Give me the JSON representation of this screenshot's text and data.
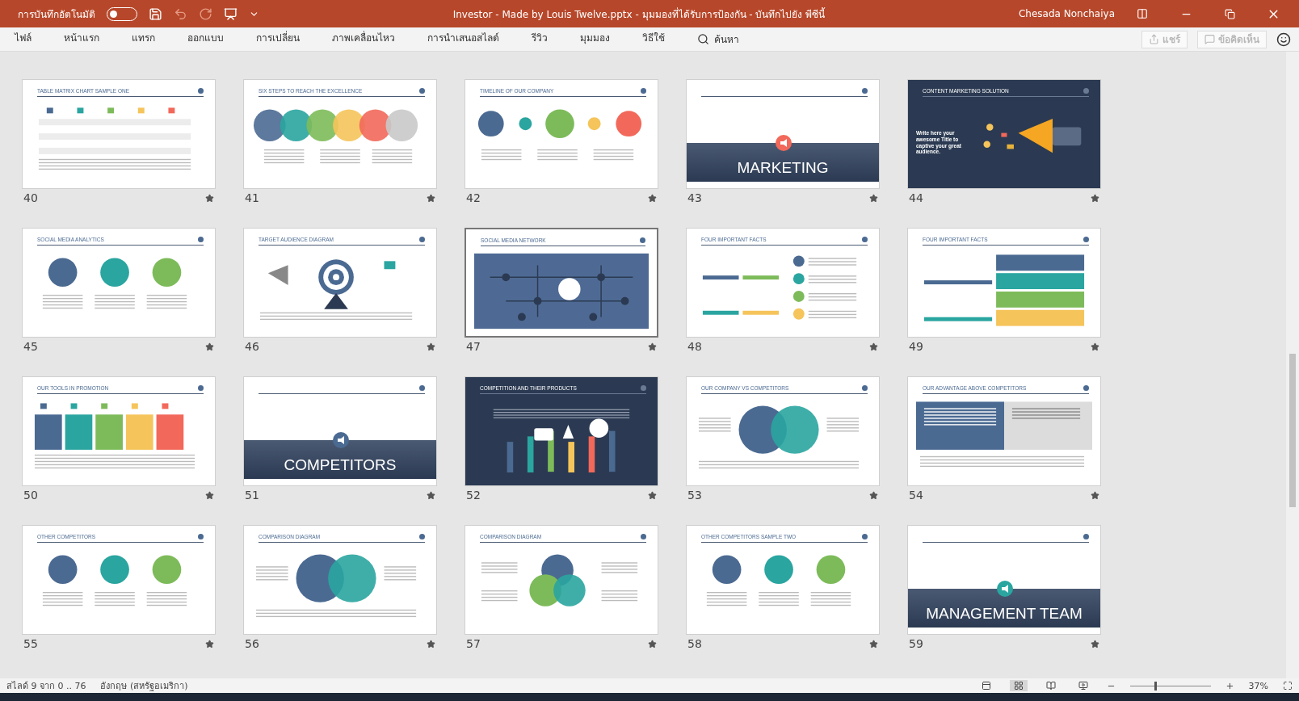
{
  "title_bar": {
    "autosave_label": "การบันทึกอัตโนมัติ",
    "autosave": {
      "on": false
    },
    "title": "Investor - Made by Louis Twelve.pptx  -  มุมมองที่ได้รับการป้องกัน  -  บันทึกไปยัง พีซีนี้",
    "user": "Chesada Nonchaiya"
  },
  "ribbon": {
    "tabs": [
      {
        "label": "ไฟล์",
        "selected": false
      },
      {
        "label": "หน้าแรก",
        "selected": false
      },
      {
        "label": "แทรก",
        "selected": false
      },
      {
        "label": "ออกแบบ",
        "selected": false
      },
      {
        "label": "การเปลี่ยน",
        "selected": false
      },
      {
        "label": "ภาพเคลื่อนไหว",
        "selected": false
      },
      {
        "label": "การนำเสนอสไลด์",
        "selected": false
      },
      {
        "label": "รีวิว",
        "selected": false
      },
      {
        "label": "มุมมอง",
        "selected": false
      },
      {
        "label": "วิธีใช้",
        "selected": false
      }
    ],
    "search": "ค้นหา",
    "buttons": [
      {
        "label": "แชร์",
        "kind": "share",
        "disabled": true
      },
      {
        "label": "ข้อคิดเห็น",
        "kind": "comment",
        "disabled": true
      }
    ]
  },
  "slides": [
    {
      "number": "40",
      "title": "TABLE MATRIX CHART SAMPLE ONE",
      "kind": "table",
      "selected": false
    },
    {
      "number": "41",
      "title": "SIX STEPS TO REACH THE EXCELLENCE",
      "kind": "circles",
      "selected": false
    },
    {
      "number": "42",
      "title": "TIMELINE OF OUR COMPANY",
      "kind": "timeline",
      "selected": false
    },
    {
      "number": "43",
      "title": "MARKETING",
      "kind": "megaphone",
      "selected": false
    },
    {
      "number": "44",
      "title": "CONTENT MARKETING SOLUTION",
      "lead": "Write here your awesome Title to captive your great audience.",
      "kind": "promo",
      "selected": false
    },
    {
      "number": "45",
      "title": "SOCIAL MEDIA ANALYTICS",
      "kind": "icons",
      "selected": false
    },
    {
      "number": "46",
      "title": "TARGET AUDIENCE DIAGRAM",
      "kind": "target",
      "selected": false
    },
    {
      "number": "47",
      "title": "SOCIAL MEDIA NETWORK",
      "kind": "network",
      "selected": true
    },
    {
      "number": "48",
      "title": "FOUR IMPORTANT FACTS",
      "kind": "list",
      "selected": false
    },
    {
      "number": "49",
      "title": "FOUR IMPORTANT FACTS",
      "kind": "bars",
      "selected": false
    },
    {
      "number": "50",
      "title": "OUR TOOLS IN PROMOTION",
      "kind": "cards",
      "selected": false
    },
    {
      "number": "51",
      "title": "COMPETITORS",
      "kind": "shuffle",
      "selected": false
    },
    {
      "number": "52",
      "title": "COMPETITION AND THEIR PRODUCTS",
      "kind": "crowd",
      "selected": false
    },
    {
      "number": "53",
      "title": "OUR COMPANY VS COMPETITORS",
      "kind": "venn",
      "selected": false
    },
    {
      "number": "54",
      "title": "OUR ADVANTAGE ABOVE COMPETITORS",
      "kind": "split",
      "selected": false
    },
    {
      "number": "55",
      "title": "OTHER COMPETITORS",
      "kind": "icons",
      "selected": false
    },
    {
      "number": "56",
      "title": "COMPARISON DIAGRAM",
      "kind": "venn",
      "selected": false
    },
    {
      "number": "57",
      "title": "COMPARISON DIAGRAM",
      "kind": "trio",
      "selected": false
    },
    {
      "number": "58",
      "title": "OTHER COMPETITORS SAMPLE TWO",
      "kind": "icons",
      "selected": false
    },
    {
      "number": "59",
      "title": "MANAGEMENT TEAM",
      "kind": "team",
      "selected": false
    }
  ],
  "status_bar": {
    "slide_info": "สไลด์ 9 จาก 0 .. 76",
    "language": "อังกฤษ (สหรัฐอเมริกา)",
    "views": [
      {
        "kind": "normal",
        "selected": false
      },
      {
        "kind": "sorter",
        "selected": true
      },
      {
        "kind": "reading",
        "selected": false
      },
      {
        "kind": "show",
        "selected": false
      }
    ],
    "zoom": {
      "level": 0.3
    },
    "zoom_label": "37%"
  }
}
